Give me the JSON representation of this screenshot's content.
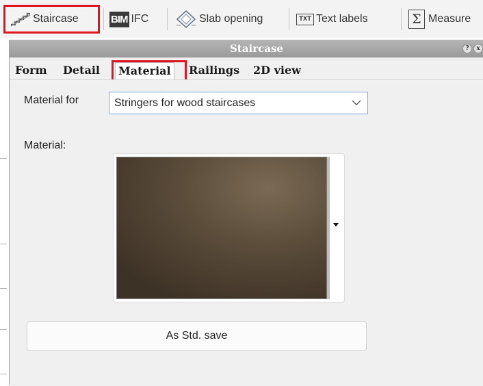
{
  "toolbar": {
    "staircase_label": "Staircase",
    "ifc_icon_text": "BIM",
    "ifc_label": "IFC",
    "slab_label": "Slab opening",
    "text_icon_text": "TXT",
    "text_label": "Text labels",
    "measure_icon_text": "Σ",
    "measure_label": "Measure"
  },
  "panel": {
    "title": "Staircase",
    "help_glyph": "?",
    "close_glyph": "x",
    "tabs": [
      {
        "label": "Form"
      },
      {
        "label": "Detail"
      },
      {
        "label": "Material",
        "active": true
      },
      {
        "label": "Railings"
      },
      {
        "label": "2D view"
      }
    ],
    "material_for_label": "Material for",
    "material_for_value": "Stringers for wood staircases",
    "material_label": "Material:",
    "save_button_label": "As Std. save"
  },
  "colors": {
    "highlight": "#e0141e",
    "panel_title_bg": "#a8a8a8",
    "swatch_base": "#4e4232",
    "swatch_light": "#7a6a55"
  },
  "icons": {
    "staircase": "staircase-icon",
    "ifc": "bim-icon",
    "slab_opening": "slab-opening-icon",
    "text_labels": "txt-icon",
    "measure": "sigma-icon"
  }
}
